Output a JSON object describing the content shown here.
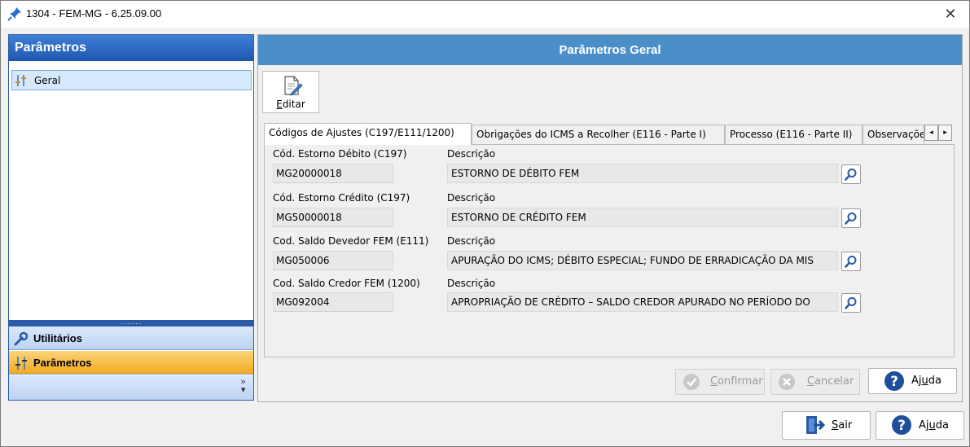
{
  "window": {
    "title": "1304 - FEM-MG - 6.25.09.00",
    "close": "✕"
  },
  "left_panel": {
    "header": "Parâmetros",
    "tree_item": "Geral",
    "splitter": "..........",
    "nav": [
      {
        "label": "Utilitários",
        "icon": "wrench-icon"
      },
      {
        "label": "Parâmetros",
        "icon": "sliders-icon"
      }
    ],
    "more": "»"
  },
  "right_panel": {
    "header": "Parâmetros Geral",
    "edit_button": {
      "first": "E",
      "rest": "ditar"
    },
    "tabs": [
      "Códigos de Ajustes (C197/E111/1200)",
      "Obrigações do ICMS a Recolher (E116 - Parte I)",
      "Processo (E116 - Parte II)",
      "Observações"
    ],
    "fields": [
      {
        "code_label": "Cód. Estorno Débito (C197)",
        "code": "MG20000018",
        "desc_label": "Descrição",
        "desc": "ESTORNO DE DÉBITO FEM"
      },
      {
        "code_label": "Cód. Estorno Crédito (C197)",
        "code": "MG50000018",
        "desc_label": "Descrição",
        "desc": "ESTORNO DE CRÉDITO FEM"
      },
      {
        "code_label": "Cod. Saldo Devedor FEM (E111)",
        "code": "MG050006",
        "desc_label": "Descrição",
        "desc": "APURAÇÃO DO ICMS; DÉBITO ESPECIAL; FUNDO DE ERRADICAÇÃO DA MIS"
      },
      {
        "code_label": "Cod. Saldo Credor FEM (1200)",
        "code": "MG092004",
        "desc_label": "Descrição",
        "desc": "APROPRIAÇÃO DE CRÉDITO – SALDO CREDOR APURADO NO PERÍODO DO"
      }
    ],
    "buttons": {
      "confirmar": {
        "first": "C",
        "rest": "onfirmar"
      },
      "cancelar": {
        "first": "C",
        "rest": "ancelar"
      },
      "ajuda": {
        "pre": "Aj",
        "u": "u",
        "post": "da"
      }
    }
  },
  "bottom": {
    "sair": {
      "first": "S",
      "rest": "air"
    },
    "ajuda": {
      "pre": "Aj",
      "u": "u",
      "post": "da"
    }
  }
}
